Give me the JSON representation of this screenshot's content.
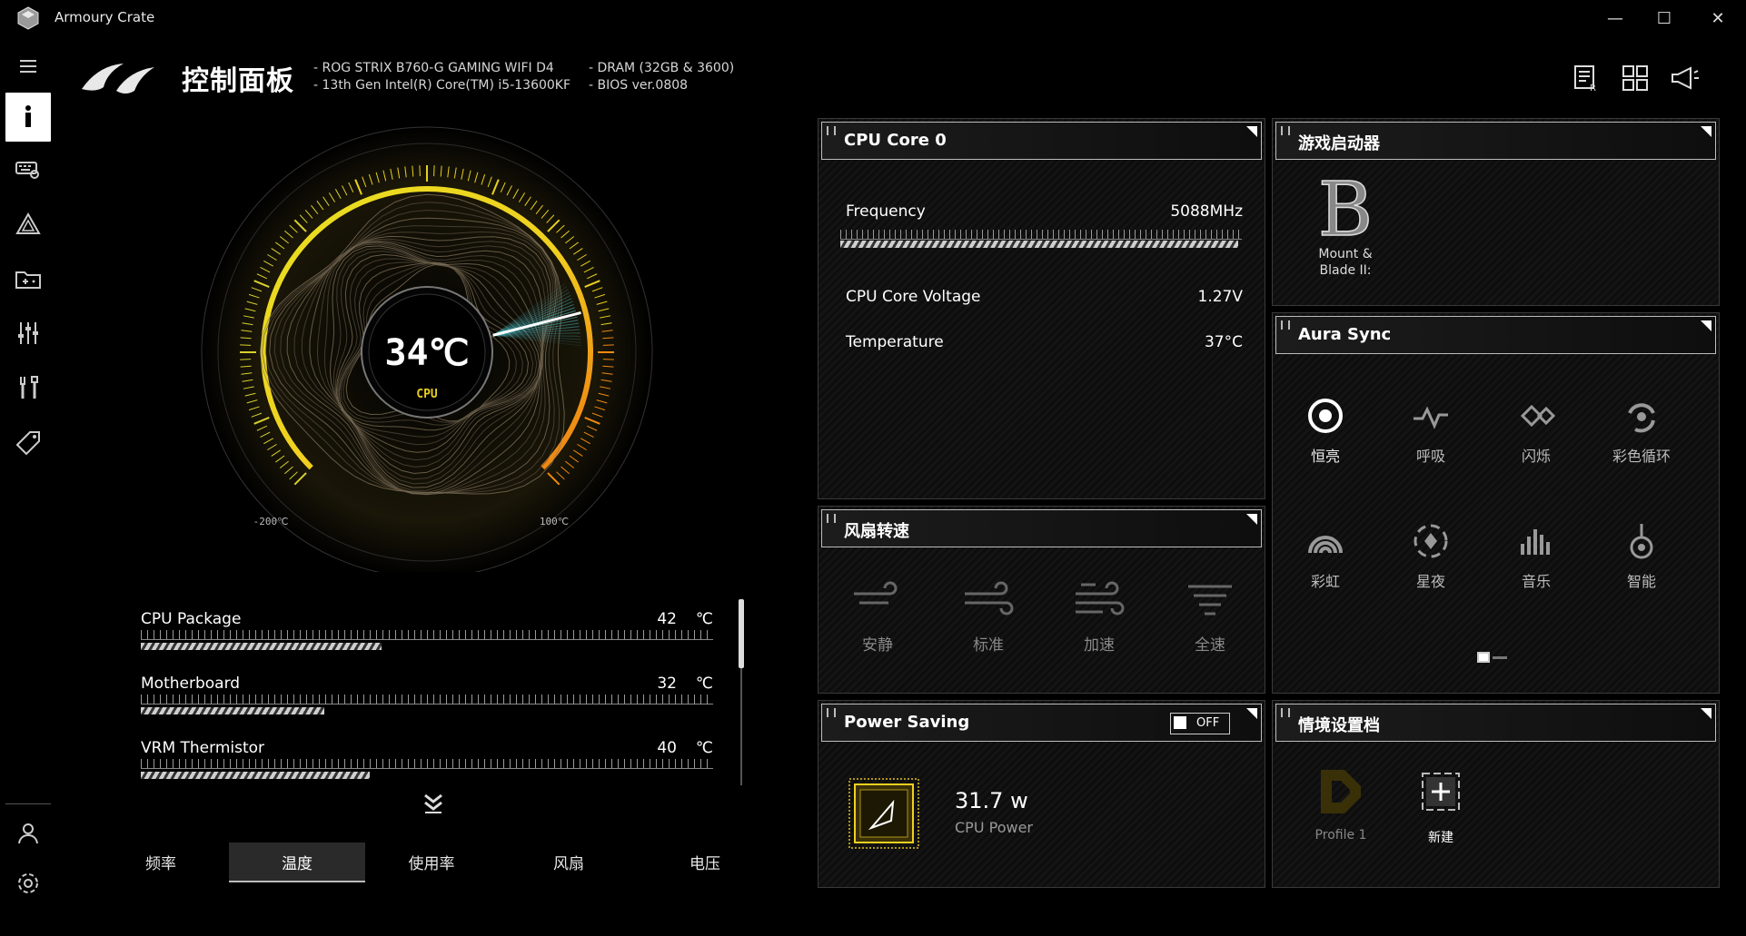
{
  "window": {
    "title": "Armoury Crate",
    "minimize": "—",
    "maximize": "☐",
    "close": "✕"
  },
  "header": {
    "title": "控制面板",
    "specs_left": [
      "-  ROG STRIX B760-G GAMING WIFI D4",
      "-  13th Gen Intel(R) Core(TM) i5-13600KF"
    ],
    "specs_right": [
      "-  DRAM (32GB & 3600)",
      "-  BIOS ver.0808"
    ]
  },
  "gauge": {
    "value": "34℃",
    "label": "CPU",
    "min_label": "-200℃",
    "max_label": "100℃",
    "needle_fraction": 0.78
  },
  "sensors": [
    {
      "name": "CPU Package",
      "value": "42",
      "unit": "℃",
      "fill": 0.42
    },
    {
      "name": "Motherboard",
      "value": "32",
      "unit": "℃",
      "fill": 0.32
    },
    {
      "name": "VRM Thermistor",
      "value": "40",
      "unit": "℃",
      "fill": 0.4
    }
  ],
  "tabs": [
    "频率",
    "温度",
    "使用率",
    "风扇",
    "电压"
  ],
  "active_tab": 1,
  "cpu_panel": {
    "title": "CPU Core 0",
    "frequency_label": "Frequency",
    "frequency_value": "5088MHz",
    "frequency_fill": 0.99,
    "voltage_label": "CPU Core Voltage",
    "voltage_value": "1.27V",
    "temp_label": "Temperature",
    "temp_value": "37°C"
  },
  "game_panel": {
    "title": "游戏启动器",
    "game_name_line1": "Mount &",
    "game_name_line2": "Blade II:"
  },
  "aura_panel": {
    "title": "Aura Sync",
    "modes": [
      "恒亮",
      "呼吸",
      "闪烁",
      "彩色循环",
      "彩虹",
      "星夜",
      "音乐",
      "智能"
    ]
  },
  "fan_panel": {
    "title": "风扇转速",
    "modes": [
      "安静",
      "标准",
      "加速",
      "全速"
    ]
  },
  "power_panel": {
    "title": "Power Saving",
    "toggle": "OFF",
    "value": "31.7 w",
    "label": "CPU Power"
  },
  "scenario_panel": {
    "title": "情境设置档",
    "profile": "Profile 1",
    "new": "新建"
  },
  "colors": {
    "accent_yellow": "#e8d020",
    "accent_orange": "#f08a10",
    "accent_cyan": "#50d8e8"
  }
}
